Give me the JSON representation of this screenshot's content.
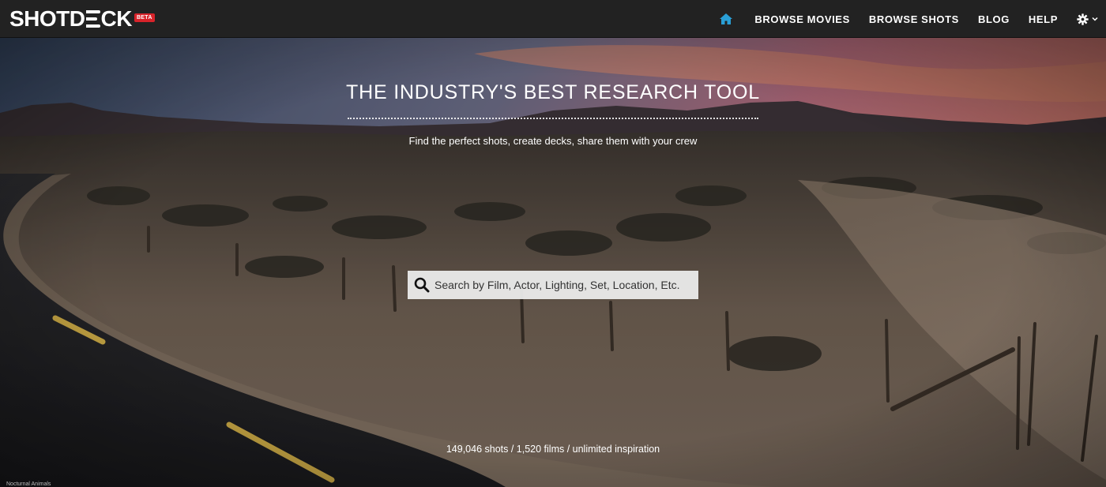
{
  "brand": {
    "logo_left": "SHOTD",
    "logo_right": "CK",
    "badge": "BETA"
  },
  "nav": {
    "home_icon": "home-icon",
    "items": [
      {
        "label": "BROWSE MOVIES"
      },
      {
        "label": "BROWSE SHOTS"
      },
      {
        "label": "BLOG"
      },
      {
        "label": "HELP"
      }
    ],
    "settings_icon": "gear-icon",
    "accent_color": "#2a9fd6"
  },
  "hero": {
    "title": "THE INDUSTRY'S BEST RESEARCH TOOL",
    "subtitle": "Find the perfect shots, create decks, share them with your crew",
    "stats": "149,046 shots / 1,520 films / unlimited inspiration",
    "image_credit": "Nocturnal Animals"
  },
  "search": {
    "placeholder": "Search by Film, Actor, Lighting, Set, Location, Etc.",
    "value": ""
  }
}
